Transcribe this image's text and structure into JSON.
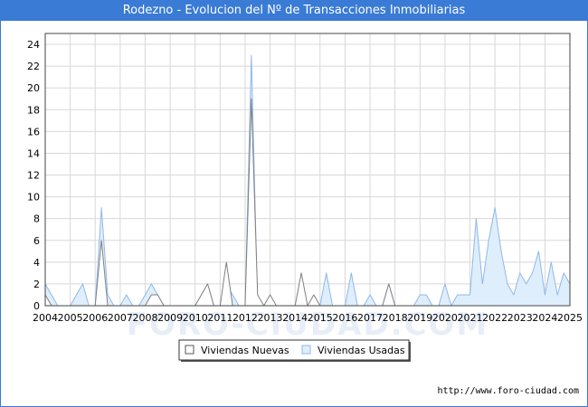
{
  "title": "Rodezno - Evolucion del Nº de Transacciones Inmobiliarias",
  "footer": "http://www.foro-ciudad.com",
  "watermark": "FORO-CIUDAD.COM",
  "colors": {
    "nuevas": "#808080",
    "usadas_line": "#8fb8ea",
    "usadas_fill": "#dfeefc",
    "title_bg": "#3a7bd5"
  },
  "chart_data": {
    "type": "area",
    "xlabel": "",
    "ylabel": "",
    "ylim": [
      0,
      25
    ],
    "yticks": [
      0,
      2,
      4,
      6,
      8,
      10,
      12,
      14,
      16,
      18,
      20,
      22,
      24
    ],
    "xlim": [
      2004,
      2025
    ],
    "xticks": [
      2004,
      2005,
      2006,
      2007,
      2008,
      2009,
      2010,
      2011,
      2012,
      2013,
      2014,
      2015,
      2016,
      2017,
      2018,
      2019,
      2020,
      2021,
      2022,
      2023,
      2024,
      2025
    ],
    "grid": true,
    "legend_position": "bottom",
    "series": [
      {
        "name": "Viviendas Nuevas",
        "points": [
          [
            2004.0,
            1
          ],
          [
            2004.25,
            0
          ],
          [
            2006.0,
            0
          ],
          [
            2006.25,
            6
          ],
          [
            2006.5,
            0
          ],
          [
            2008.0,
            0
          ],
          [
            2008.25,
            1
          ],
          [
            2008.5,
            1
          ],
          [
            2008.75,
            0
          ],
          [
            2010.0,
            0
          ],
          [
            2010.5,
            2
          ],
          [
            2010.75,
            0
          ],
          [
            2011.0,
            0
          ],
          [
            2011.25,
            4
          ],
          [
            2011.5,
            0
          ],
          [
            2012.0,
            0
          ],
          [
            2012.25,
            19
          ],
          [
            2012.5,
            1
          ],
          [
            2012.75,
            0
          ],
          [
            2013.0,
            1
          ],
          [
            2013.25,
            0
          ],
          [
            2014.0,
            0
          ],
          [
            2014.25,
            3
          ],
          [
            2014.5,
            0
          ],
          [
            2014.75,
            1
          ],
          [
            2015.0,
            0
          ],
          [
            2017.5,
            0
          ],
          [
            2017.75,
            2
          ],
          [
            2018.0,
            0
          ],
          [
            2025.0,
            0
          ]
        ]
      },
      {
        "name": "Viviendas Usadas",
        "points": [
          [
            2004.0,
            2
          ],
          [
            2004.5,
            0
          ],
          [
            2005.0,
            0
          ],
          [
            2005.5,
            2
          ],
          [
            2005.75,
            0
          ],
          [
            2006.0,
            0
          ],
          [
            2006.25,
            9
          ],
          [
            2006.5,
            1
          ],
          [
            2006.75,
            0
          ],
          [
            2007.0,
            0
          ],
          [
            2007.25,
            1
          ],
          [
            2007.5,
            0
          ],
          [
            2007.75,
            0
          ],
          [
            2008.0,
            1
          ],
          [
            2008.25,
            2
          ],
          [
            2008.5,
            1
          ],
          [
            2008.75,
            0
          ],
          [
            2010.0,
            0
          ],
          [
            2010.5,
            2
          ],
          [
            2010.75,
            0
          ],
          [
            2011.0,
            0
          ],
          [
            2011.25,
            2
          ],
          [
            2011.5,
            1
          ],
          [
            2011.75,
            0
          ],
          [
            2012.0,
            0
          ],
          [
            2012.25,
            23
          ],
          [
            2012.5,
            0
          ],
          [
            2014.0,
            0
          ],
          [
            2014.25,
            2
          ],
          [
            2014.5,
            0
          ],
          [
            2015.0,
            0
          ],
          [
            2015.25,
            3
          ],
          [
            2015.5,
            0
          ],
          [
            2016.0,
            0
          ],
          [
            2016.25,
            3
          ],
          [
            2016.5,
            0
          ],
          [
            2016.75,
            0
          ],
          [
            2017.0,
            1
          ],
          [
            2017.25,
            0
          ],
          [
            2017.5,
            0
          ],
          [
            2017.75,
            2
          ],
          [
            2018.0,
            0
          ],
          [
            2018.75,
            0
          ],
          [
            2019.0,
            1
          ],
          [
            2019.25,
            1
          ],
          [
            2019.5,
            0
          ],
          [
            2019.75,
            0
          ],
          [
            2020.0,
            2
          ],
          [
            2020.25,
            0
          ],
          [
            2020.5,
            1
          ],
          [
            2020.75,
            1
          ],
          [
            2021.0,
            1
          ],
          [
            2021.25,
            8
          ],
          [
            2021.5,
            2
          ],
          [
            2021.75,
            6
          ],
          [
            2022.0,
            9
          ],
          [
            2022.25,
            5
          ],
          [
            2022.5,
            2
          ],
          [
            2022.75,
            1
          ],
          [
            2023.0,
            3
          ],
          [
            2023.25,
            2
          ],
          [
            2023.5,
            3
          ],
          [
            2023.75,
            5
          ],
          [
            2024.0,
            1
          ],
          [
            2024.25,
            4
          ],
          [
            2024.5,
            1
          ],
          [
            2024.75,
            3
          ],
          [
            2025.0,
            2
          ],
          [
            2025.25,
            1
          ],
          [
            2025.5,
            0
          ]
        ]
      }
    ]
  }
}
